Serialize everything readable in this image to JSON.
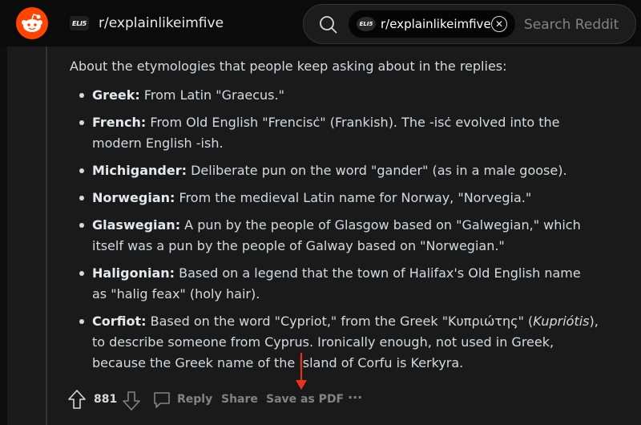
{
  "header": {
    "logo_icon": "reddit-snoo-icon",
    "subreddit_icon_text": "ELI5",
    "subreddit_name": "r/explainlikeimfive",
    "search": {
      "chip_icon_text": "ELI5",
      "chip_label": "r/explainlikeimfive",
      "placeholder": "Search Reddit"
    }
  },
  "comment": {
    "intro": "About the etymologies that people keep asking about in the replies:",
    "items": [
      {
        "term": "Greek:",
        "text": " From Latin \"Graecus.\""
      },
      {
        "term": "French:",
        "text": " From Old English \"Frencisċ\" (Frankish). The -isċ evolved into the modern English -ish."
      },
      {
        "term": "Michigander:",
        "text": " Deliberate pun on the word \"gander\" (as in a male goose)."
      },
      {
        "term": "Norwegian:",
        "text": " From the medieval Latin name for Norway, \"Norvegia.\""
      },
      {
        "term": "Glaswegian:",
        "text": " A pun by the people of Glasgow based on \"Galwegian,\" which itself was a pun by the people of Galway based on \"Norwegian.\""
      },
      {
        "term": "Haligonian:",
        "text": " Based on a legend that the town of Halifax's Old English name as \"halig feax\" (holy hair)."
      },
      {
        "term": "Corfiot:",
        "text_before": " Based on the word \"Cypriot,\" from the Greek \"Κυπριώτης\" (",
        "italic": "Kupriótis",
        "text_after": "), to describe someone from Cyprus. Ironically enough, not used in Greek, because the Greek name of the island of Corfu is Kerkyra."
      }
    ]
  },
  "actions": {
    "score": "881",
    "reply": "Reply",
    "share": "Share",
    "save_pdf": "Save as PDF",
    "more": "···"
  },
  "colors": {
    "accent": "#ff4500",
    "annotation_arrow": "#e8321e",
    "background": "#1a1a1b"
  }
}
